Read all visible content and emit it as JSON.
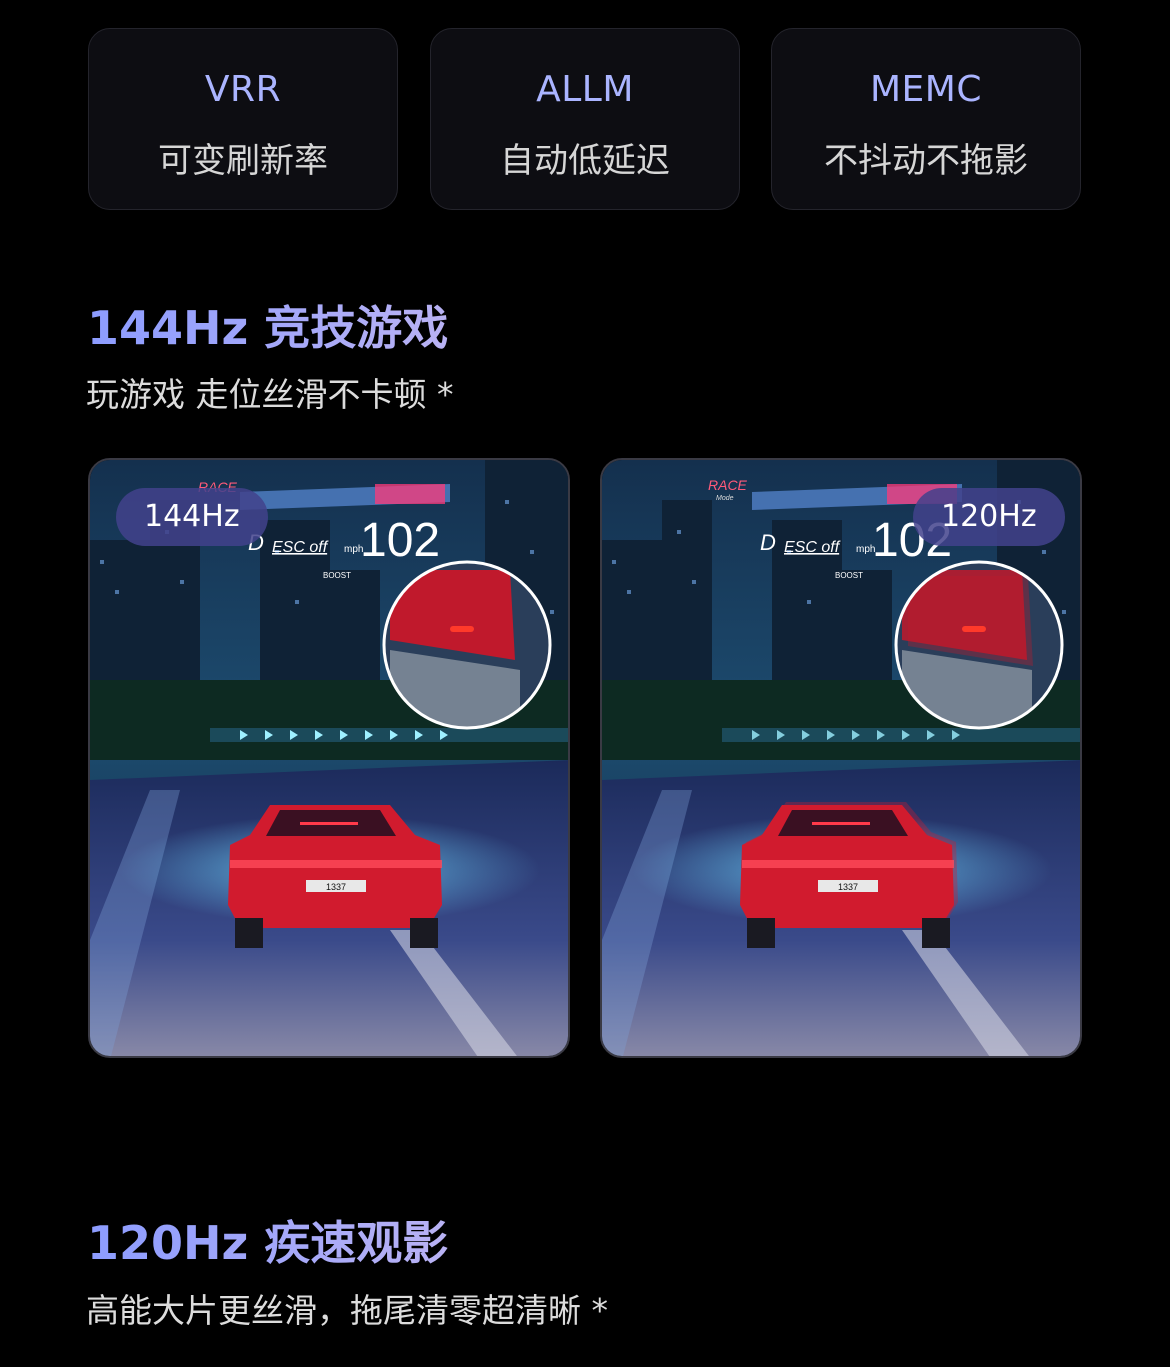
{
  "features": [
    {
      "title": "VRR",
      "subtitle": "可变刷新率"
    },
    {
      "title": "ALLM",
      "subtitle": "自动低延迟"
    },
    {
      "title": "MEMC",
      "subtitle": "不抖动不拖影"
    }
  ],
  "section_gaming": {
    "title": "144Hz 竞技游戏",
    "subtitle": "玩游戏 走位丝滑不卡顿 *"
  },
  "comparison": {
    "left_label": "144Hz",
    "right_label": "120Hz",
    "hud": {
      "race": "RACE",
      "mode": "Mode",
      "gear": "D",
      "esc": "ESC off",
      "unit": "mph",
      "speed": "102",
      "boost": "BOOST",
      "plate": "1337"
    }
  },
  "section_movie": {
    "title": "120Hz 疾速观影",
    "subtitle": "高能大片更丝滑，拖尾清零超清晰 *"
  },
  "colors": {
    "accent": "#a9b3ff",
    "background": "#000000",
    "pill": "#42428c"
  }
}
